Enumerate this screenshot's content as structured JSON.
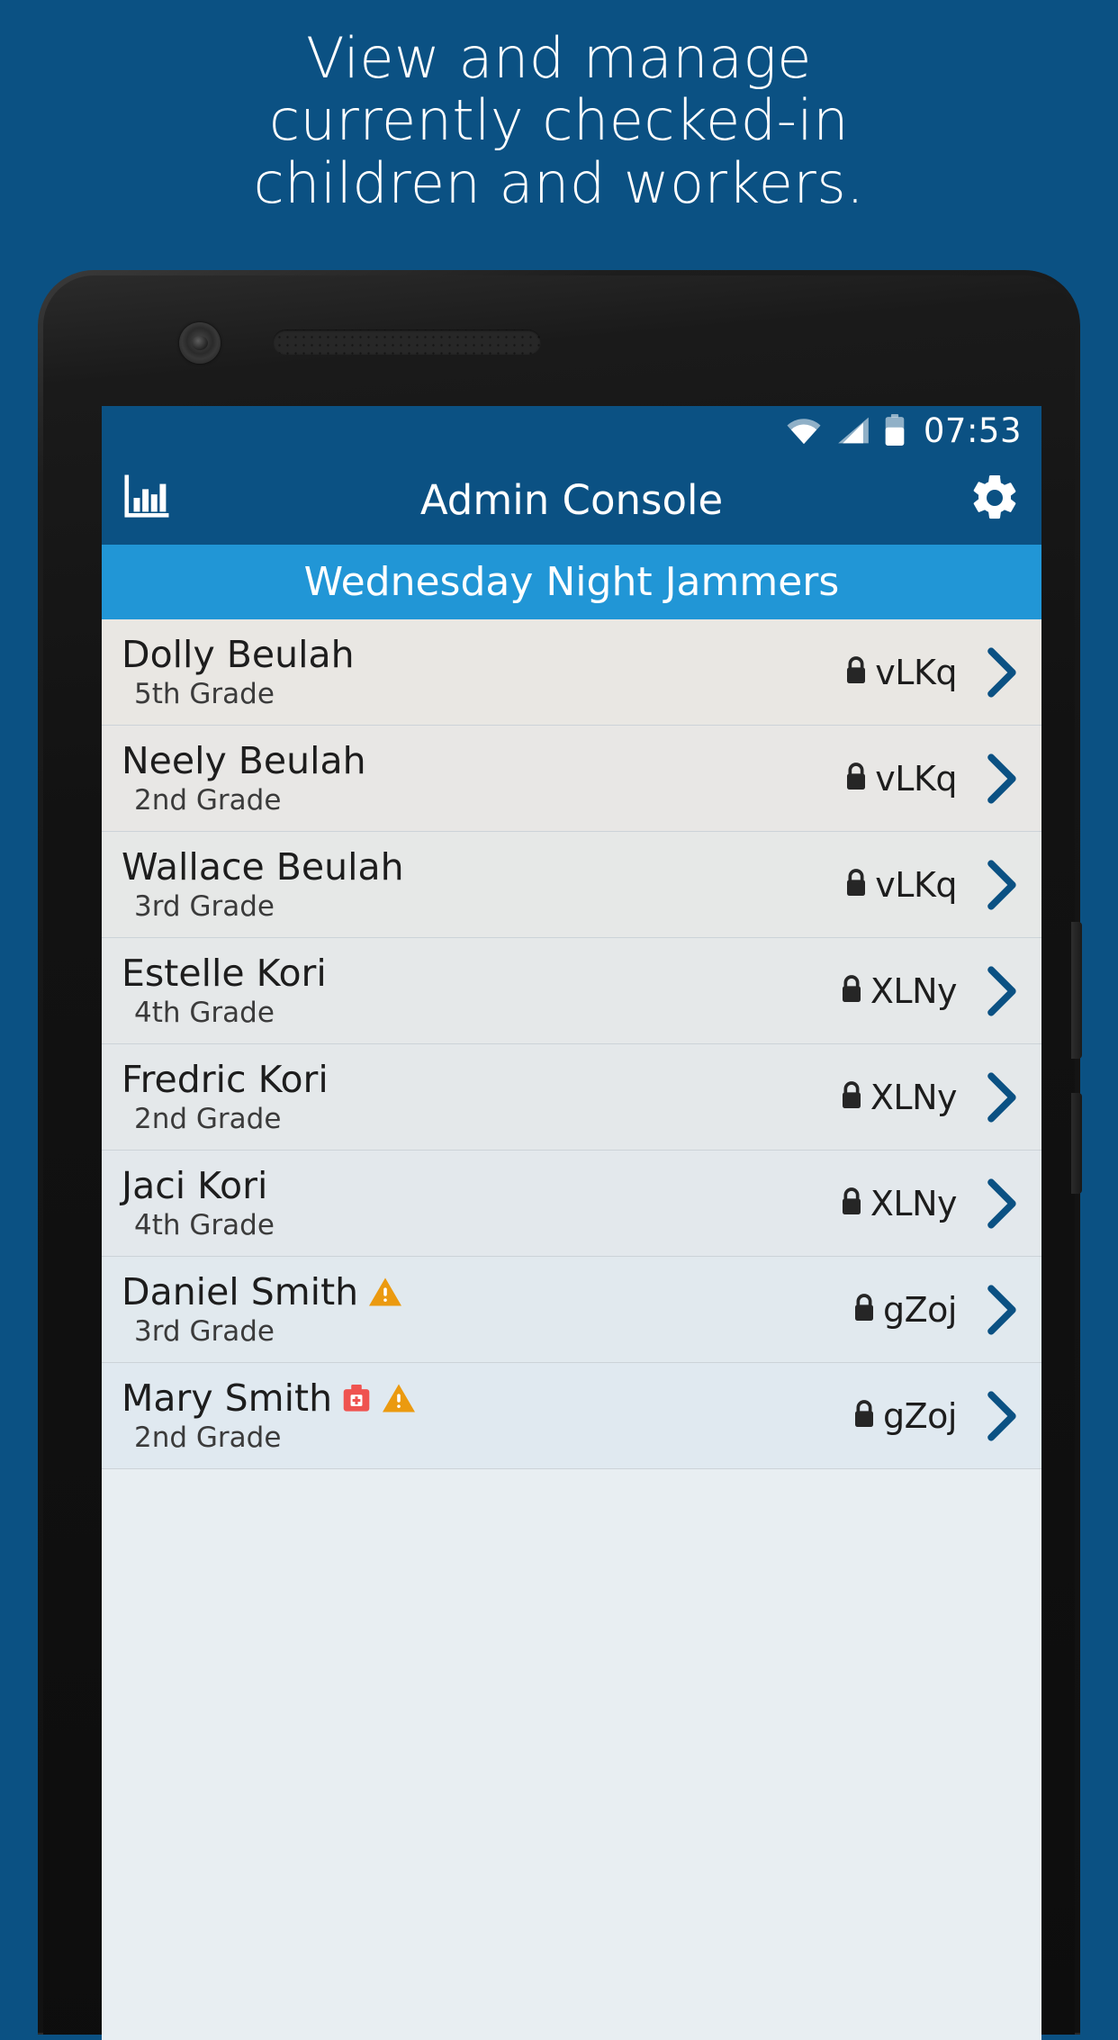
{
  "promo": {
    "lines": [
      "View and manage",
      "currently checked-in",
      "children and workers."
    ]
  },
  "colors": {
    "page_background": "#0b5183",
    "appbar": "#0b5183",
    "subheader": "#2196d6",
    "chevron": "#0b5183",
    "warning": "#eb9a10",
    "medical": "#ef5350",
    "list_background": "#e9eef2"
  },
  "statusbar": {
    "time": "07:53",
    "icons": [
      "wifi-icon",
      "cell-signal-icon",
      "battery-icon"
    ]
  },
  "appbar": {
    "left_icon": "bar-chart-icon",
    "title": "Admin Console",
    "right_icon": "gear-icon"
  },
  "subheader": {
    "title": "Wednesday Night Jammers"
  },
  "list": {
    "rows": [
      {
        "name": "Dolly Beulah",
        "grade": "5th Grade",
        "code": "vLKq",
        "lock": true,
        "badges": []
      },
      {
        "name": "Neely Beulah",
        "grade": "2nd Grade",
        "code": "vLKq",
        "lock": true,
        "badges": []
      },
      {
        "name": "Wallace Beulah",
        "grade": "3rd Grade",
        "code": "vLKq",
        "lock": true,
        "badges": []
      },
      {
        "name": "Estelle Kori",
        "grade": "4th Grade",
        "code": "XLNy",
        "lock": true,
        "badges": []
      },
      {
        "name": "Fredric Kori",
        "grade": "2nd Grade",
        "code": "XLNy",
        "lock": true,
        "badges": []
      },
      {
        "name": "Jaci Kori",
        "grade": "4th Grade",
        "code": "XLNy",
        "lock": true,
        "badges": []
      },
      {
        "name": "Daniel Smith",
        "grade": "3rd Grade",
        "code": "gZoj",
        "lock": true,
        "badges": [
          "warning-icon"
        ]
      },
      {
        "name": "Mary Smith",
        "grade": "2nd Grade",
        "code": "gZoj",
        "lock": true,
        "badges": [
          "medical-kit-icon",
          "warning-icon"
        ]
      }
    ]
  }
}
